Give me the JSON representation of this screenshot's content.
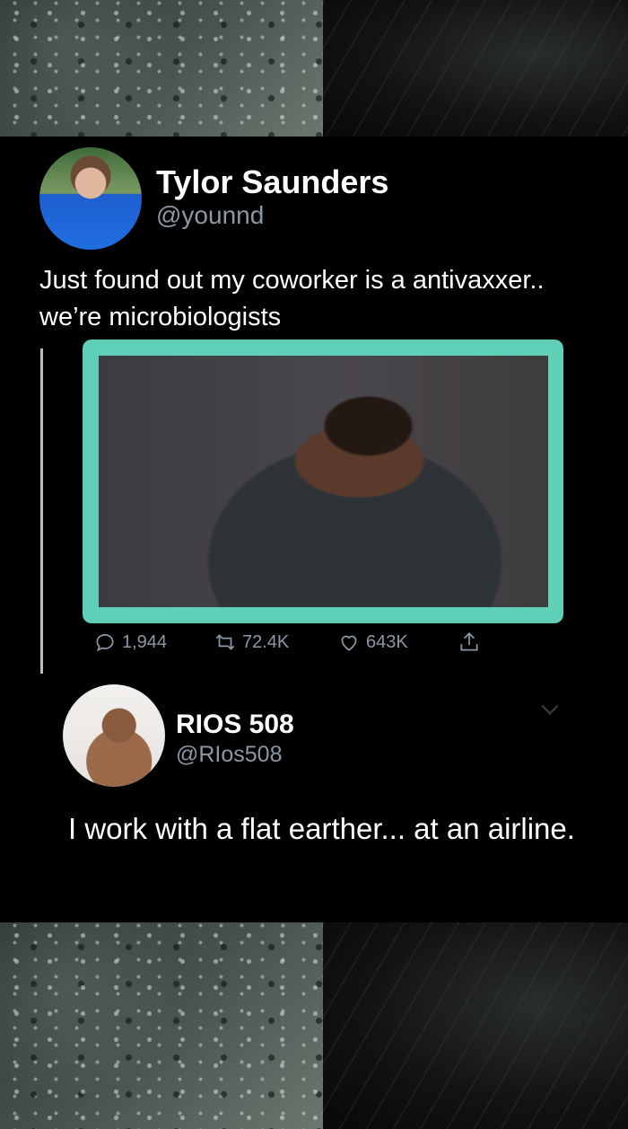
{
  "tweet": {
    "author": {
      "name": "Tylor Saunders",
      "handle": "@younnd"
    },
    "text_line1": "Just found out my coworker is a antivaxxer..",
    "text_line2": "we’re microbiologists",
    "media": {
      "accent_color": "#5fcfb8"
    },
    "actions": {
      "replies": "1,944",
      "retweets": "72.4K",
      "likes": "643K"
    }
  },
  "reply": {
    "author": {
      "name": "RIOS 508",
      "handle": "@RIos508"
    },
    "text": "I work with a flat earther... at an airline."
  },
  "colors": {
    "background": "#000000",
    "text": "#ffffff",
    "secondary_text": "#8b98a5",
    "media_frame": "#5fcfb8"
  }
}
